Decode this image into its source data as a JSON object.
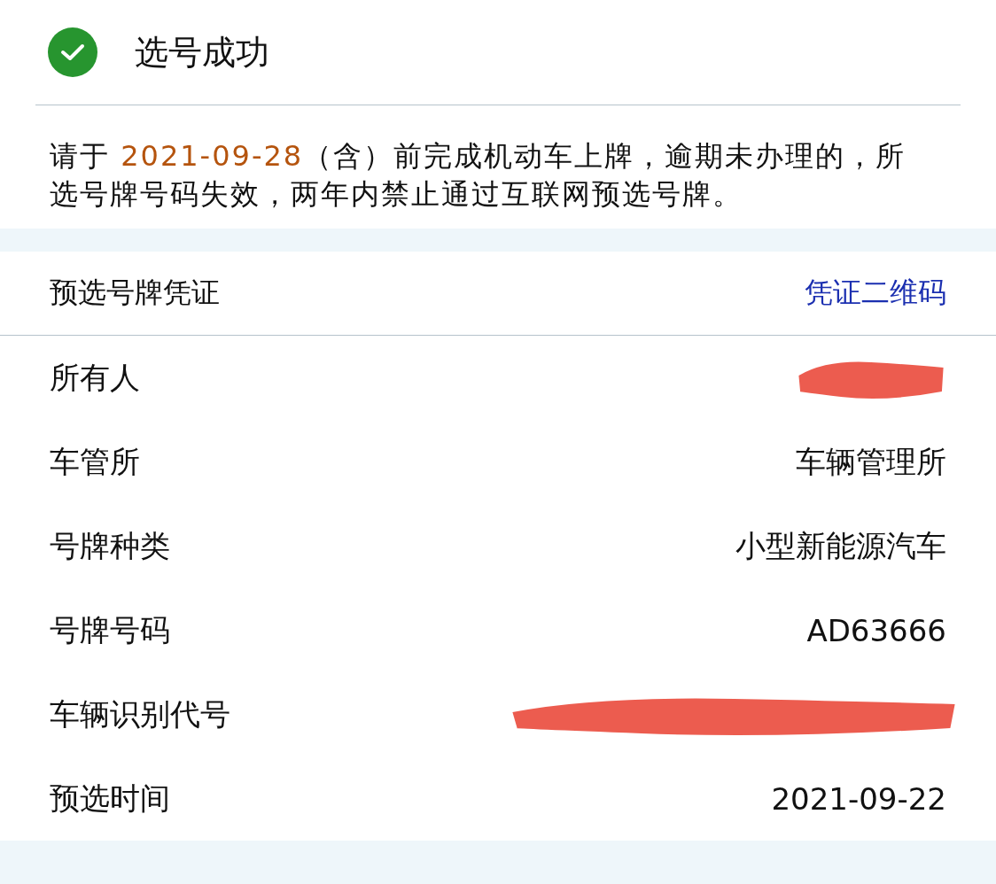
{
  "header": {
    "title": "选号成功"
  },
  "notice": {
    "text": "请于 **2021-09-28**（含）前完成机动车上牌，逾期未办理的，所选号牌号码失效，两年内禁止通过互联网预选号牌。"
  },
  "voucher": {
    "title": "预选号牌凭证",
    "link": "凭证二维码"
  },
  "rows": [
    {
      "label": "所有人",
      "redacted": true
    },
    {
      "label": "车管所",
      "value": "车辆管理所",
      "redacted": false
    },
    {
      "label": "号牌种类",
      "value": "小型新能源汽车",
      "redacted": false
    },
    {
      "label": "号牌号码",
      "value": "AD63666",
      "redacted": false
    },
    {
      "label": "车辆识别代号",
      "redacted": true
    },
    {
      "label": "预选时间",
      "value": "2021-09-22",
      "redacted": false
    }
  ]
}
